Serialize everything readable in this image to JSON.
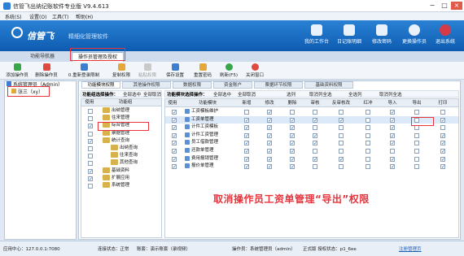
{
  "title": "信管飞出纳记账软件专业版 V9.4.613",
  "menu": [
    "系统(S)",
    "设置(O)",
    "工具(T)",
    "帮助(H)"
  ],
  "brand": {
    "name": "信管飞",
    "slogan": "精细化管理软件"
  },
  "header_buttons": [
    "我的工作台",
    "日记账明细",
    "修改密码",
    "更换操作员",
    "退出系统"
  ],
  "main_tabs": [
    "功能导航器",
    "操作员管理及授权"
  ],
  "toolbar": [
    {
      "label": "添加操作员",
      "disabled": false
    },
    {
      "label": "删除操作员",
      "disabled": false
    },
    {
      "label": "0.重新登录限制",
      "disabled": false
    },
    {
      "label": "复制权限",
      "disabled": false
    },
    {
      "label": "粘贴权限",
      "disabled": true
    },
    {
      "label": "保存设置",
      "disabled": false
    },
    {
      "label": "重置密码",
      "disabled": false
    },
    {
      "label": "刷新(F5)",
      "disabled": false
    },
    {
      "label": "关闭窗口",
      "disabled": false
    }
  ],
  "tree": {
    "root": "系统管理员（Admin）",
    "user": "张三（xy）"
  },
  "sub_tabs": [
    "功能模块权限",
    "其他操作权限",
    "数据权限",
    "资金账户",
    "票据环节权限",
    "基础资料权限"
  ],
  "group_options": {
    "title": "功能组选择操作：",
    "select_all": "全部选中",
    "cancel_all": "全部取消"
  },
  "module_options": {
    "title": "功能模块选择操作：",
    "select_all": "全部选中",
    "cancel_all": "全部取消",
    "select_col": "选列",
    "cancel_col": "取消列全选",
    "select_row": "全选列",
    "cancel_row": "取消列全选"
  },
  "group_table": {
    "headers": [
      "使用",
      "功能组"
    ],
    "rows": [
      {
        "name": "出纳管理",
        "checked": false
      },
      {
        "name": "往来管理",
        "checked": false
      },
      {
        "name": "综合管理",
        "checked": true
      },
      {
        "name": "票据管理",
        "checked": false
      },
      {
        "name": "统计查询",
        "checked": true
      },
      {
        "name": "出纳查询",
        "checked": false
      },
      {
        "name": "往来查询",
        "checked": false
      },
      {
        "name": "其他查询",
        "checked": false
      },
      {
        "name": "基础资料",
        "checked": true
      },
      {
        "name": "扩展应用",
        "checked": true
      },
      {
        "name": "系统管理",
        "checked": false
      }
    ]
  },
  "module_table": {
    "headers": [
      "使用",
      "功能模块",
      "新增",
      "修改",
      "删除",
      "审核",
      "反审核改",
      "红冲",
      "导入",
      "导出",
      "打印"
    ],
    "rows": [
      {
        "name": "工资模板维护",
        "use": true,
        "checks": [
          false,
          true,
          false,
          false,
          false,
          false,
          true,
          false,
          false
        ]
      },
      {
        "name": "工资单管理",
        "use": true,
        "checks": [
          true,
          true,
          true,
          true,
          true,
          false,
          true,
          false,
          true
        ]
      },
      {
        "name": "计件工资模板",
        "use": true,
        "checks": [
          true,
          true,
          true,
          false,
          false,
          false,
          true,
          false,
          false
        ]
      },
      {
        "name": "计件工资管理",
        "use": true,
        "checks": [
          true,
          true,
          true,
          true,
          false,
          false,
          true,
          false,
          true
        ]
      },
      {
        "name": "员工借款管理",
        "use": true,
        "checks": [
          true,
          true,
          true,
          true,
          false,
          false,
          true,
          false,
          true
        ]
      },
      {
        "name": "还款单管理",
        "use": true,
        "checks": [
          true,
          true,
          true,
          false,
          false,
          false,
          false,
          false,
          true
        ]
      },
      {
        "name": "费用报销管理",
        "use": true,
        "checks": [
          true,
          true,
          true,
          true,
          true,
          false,
          true,
          false,
          true
        ]
      },
      {
        "name": "报价单管理",
        "use": true,
        "checks": [
          true,
          true,
          true,
          false,
          false,
          false,
          true,
          false,
          true
        ]
      }
    ]
  },
  "annotation": "取消操作员工资单管理“导出”权限",
  "status": {
    "center": "应用中心：127.0.0.1:7080",
    "conn": "连接状态：正常",
    "account": "账套：演示账套（录视频）",
    "operator": "操作员：系统管理员（admin）",
    "version": "正式版 授权状态：p1_6ee",
    "link": "注册管理页"
  },
  "colors": {
    "banner": "#1670c9",
    "highlight": "#e8343c",
    "check": "#1a5fb4"
  }
}
